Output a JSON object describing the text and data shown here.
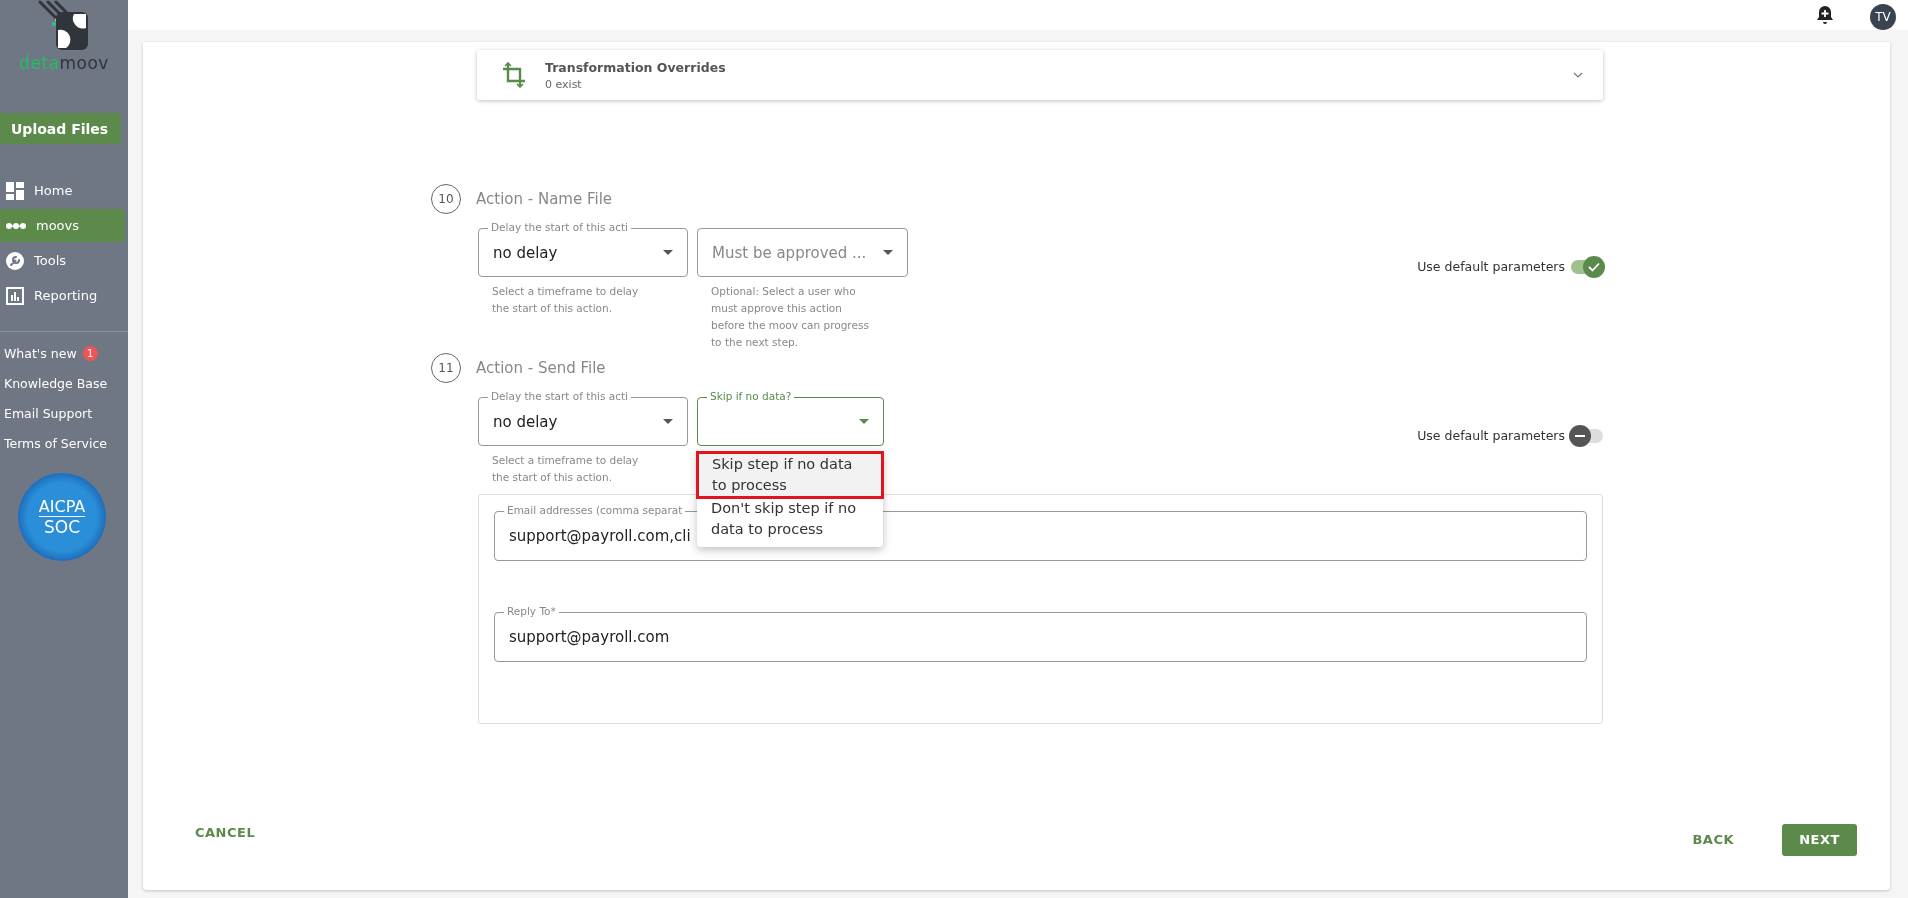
{
  "sidebar": {
    "logo": {
      "part_1": "deta",
      "part_2": "moov"
    },
    "upload_button": "Upload Files",
    "nav": [
      {
        "label": "Home",
        "selected": false
      },
      {
        "label": "moovs",
        "selected": true
      },
      {
        "label": "Tools",
        "selected": false
      },
      {
        "label": "Reporting",
        "selected": false
      }
    ],
    "links": [
      {
        "label": "What's new",
        "badge": "1"
      },
      {
        "label": "Knowledge Base"
      },
      {
        "label": "Email Support"
      },
      {
        "label": "Terms of Service"
      }
    ],
    "certification": {
      "line_1": "AICPA",
      "line_2": "SOC"
    }
  },
  "top_bar": {
    "avatar": "TV"
  },
  "overrides": {
    "title": "Transformation Overrides",
    "subtitle": "0 exist"
  },
  "actions": [
    {
      "number": "10",
      "title": "Action - Name File",
      "fields": [
        {
          "label": "Delay the start of this acti",
          "value": "no delay",
          "helper": "Select a timeframe to delay the start of this action.",
          "focused": false
        },
        {
          "placeholder": "Must be approved ...",
          "helper": "Optional: Select a user who must approve this action before the moov can progress to the next step.",
          "focused": false
        }
      ],
      "use_default": {
        "label": "Use default parameters",
        "on": true
      }
    },
    {
      "number": "11",
      "title": "Action - Send File",
      "fields": [
        {
          "label": "Delay the start of this acti",
          "value": "no delay",
          "helper": "Select a timeframe to delay the start of this action.",
          "focused": false
        },
        {
          "label": "Skip if no data?",
          "focused": true,
          "menu": [
            {
              "label": "Skip step if no data to process",
              "selected": true
            },
            {
              "label": "Don't skip step if no data to process",
              "selected": false
            }
          ]
        }
      ],
      "use_default": {
        "label": "Use default parameters",
        "on": false
      },
      "email": [
        {
          "label": "Email addresses (comma separat",
          "value": "support@payroll.com,cli"
        },
        {
          "label": "Reply To*",
          "value": "support@payroll.com"
        }
      ]
    }
  ],
  "footer": {
    "cancel": "CANCEL",
    "back": "BACK",
    "next": "NEXT"
  }
}
